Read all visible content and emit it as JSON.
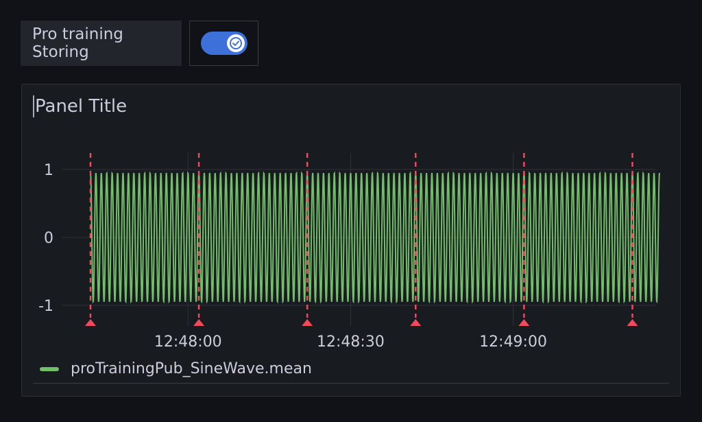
{
  "variable": {
    "label": "Pro training Storing",
    "toggle_on": true,
    "toggle_color": "#3d71d9"
  },
  "panel": {
    "title": "Panel Title"
  },
  "chart_data": {
    "type": "line",
    "y_ticks": [
      "1",
      "0",
      "-1"
    ],
    "ylim": [
      -1,
      1
    ],
    "x_ticks": [
      "12:48:00",
      "12:48:30",
      "12:49:00"
    ],
    "x_tick_seconds": [
      0,
      30,
      60
    ],
    "xlim_seconds": [
      -18,
      87
    ],
    "series": [
      {
        "name": "proTrainingPub_SineWave.mean",
        "color": "#73bf69",
        "function": "sine",
        "amplitude": 0.95,
        "cycles_per_second": 1
      }
    ],
    "annotations_seconds": [
      -18,
      2,
      22,
      42,
      62,
      82
    ],
    "annotation_color": "#f2495c",
    "grid": true,
    "legend_position": "bottom-left"
  }
}
